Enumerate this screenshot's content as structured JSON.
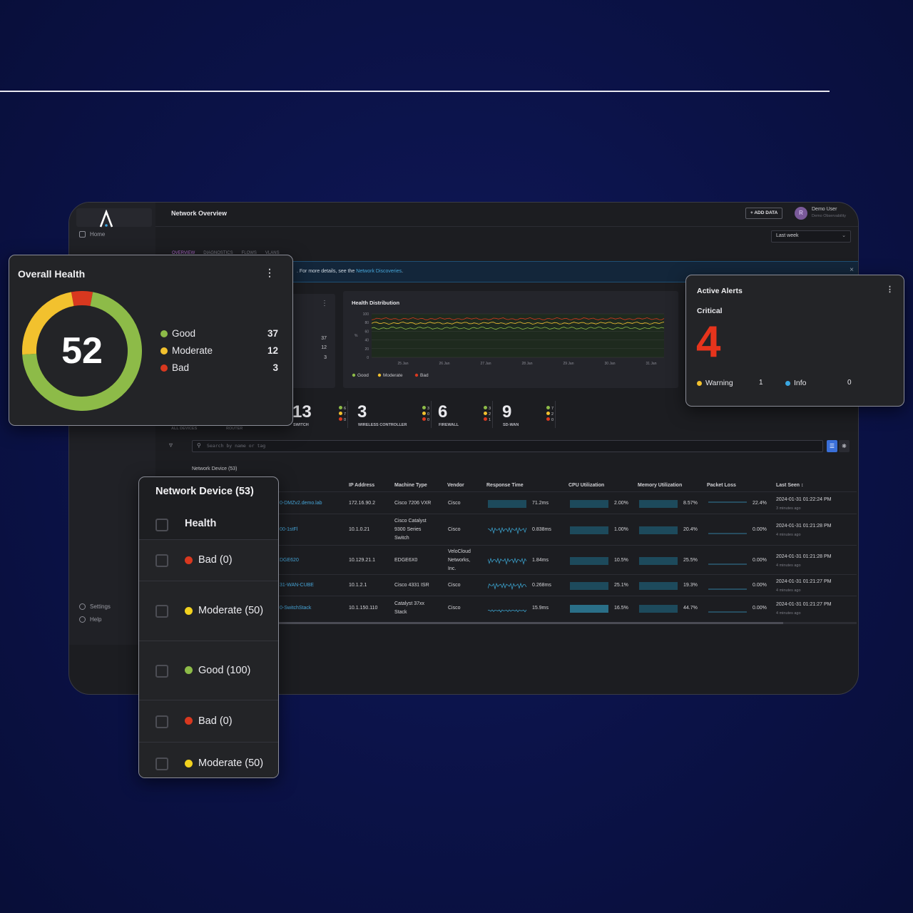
{
  "app": {
    "title": "Network Overview",
    "add_data_label": "+ ADD DATA",
    "user": {
      "avatar_initial": "R",
      "name": "Demo User",
      "org": "Demo Observability"
    },
    "time_range": "Last week",
    "sidebar": {
      "items": [
        {
          "label": "Home",
          "icon": "home-icon"
        },
        {
          "label": "Settings",
          "icon": "gear-icon"
        },
        {
          "label": "Help",
          "icon": "help-icon"
        }
      ]
    },
    "tabs": [
      "OVERVIEW",
      "DIAGNOSTICS",
      "FLOWS",
      "VLANS"
    ],
    "banner": {
      "message": ". For more details, see the ",
      "link": "Network Discoveries",
      "end": "."
    }
  },
  "health_counts_panel": {
    "good": "37",
    "moderate": "12",
    "bad": "3"
  },
  "health_distribution": {
    "title": "Health Distribution",
    "y_ticks": [
      "100",
      "80",
      "60",
      "40",
      "20",
      "0"
    ],
    "y_label": "%",
    "x_ticks": [
      "25 Jan",
      "26 Jan",
      "27 Jan",
      "28 Jan",
      "29 Jan",
      "30 Jan",
      "31 Jan"
    ],
    "legend": [
      {
        "label": "Good",
        "color": "#8dbb48"
      },
      {
        "label": "Moderate",
        "color": "#f2c12e"
      },
      {
        "label": "Bad",
        "color": "#d8381f"
      }
    ]
  },
  "categories": [
    {
      "count": "13",
      "label": "SWITCH",
      "good": "6",
      "moderate": "7",
      "bad": "0"
    },
    {
      "count": "3",
      "label": "WIRELESS CONTROLLER",
      "good": "3",
      "moderate": "0",
      "bad": "0"
    },
    {
      "count": "6",
      "label": "FIREWALL",
      "good": "3",
      "moderate": "2",
      "bad": "1"
    },
    {
      "count": "9",
      "label": "SD-WAN",
      "good": "7",
      "moderate": "2",
      "bad": "0"
    }
  ],
  "category_left_labels": [
    "ALL DEVICES",
    "ROUTER"
  ],
  "search_placeholder": "Search by name or tag",
  "table": {
    "caption": "Network Device (53)",
    "columns": [
      "IP Address",
      "Machine Type",
      "Vendor",
      "Response Time",
      "CPU Utilization",
      "Memory Utilization",
      "Packet Loss",
      "Last Seen"
    ],
    "rows": [
      {
        "name": "0-DMZv2.demo.lab",
        "ip": "172.16.90.2",
        "type": [
          "Cisco 7206 VXR"
        ],
        "vendor": [
          "Cisco"
        ],
        "response": "71.2ms",
        "cpu": "2.00%",
        "mem": "8.57%",
        "loss": "22.4%",
        "seen": "2024-01-31 01:22:24 PM",
        "seen_ago": "3 minutes ago"
      },
      {
        "name": "00-1stFl",
        "ip": "10.1.0.21",
        "type": [
          "Cisco Catalyst",
          "9300 Series",
          "Switch"
        ],
        "vendor": [
          "Cisco"
        ],
        "response": "0.838ms",
        "cpu": "1.00%",
        "mem": "20.4%",
        "loss": "0.00%",
        "seen": "2024-01-31 01:21:28 PM",
        "seen_ago": "4 minutes ago"
      },
      {
        "name": "DGE620",
        "ip": "10.129.21.1",
        "type": [
          "EDGE6X0"
        ],
        "vendor": [
          "VeloCloud",
          "Networks,",
          "Inc."
        ],
        "response": "1.84ms",
        "cpu": "10.5%",
        "mem": "25.5%",
        "loss": "0.00%",
        "seen": "2024-01-31 01:21:28 PM",
        "seen_ago": "4 minutes ago"
      },
      {
        "name": "31-WAN-CUBE",
        "ip": "10.1.2.1",
        "type": [
          "Cisco 4331 ISR"
        ],
        "vendor": [
          "Cisco"
        ],
        "response": "0.268ms",
        "cpu": "25.1%",
        "mem": "19.3%",
        "loss": "0.00%",
        "seen": "2024-01-31 01:21:27 PM",
        "seen_ago": "4 minutes ago"
      },
      {
        "name": "0-SwitchStack",
        "ip": "10.1.150.110",
        "type": [
          "Catalyst 37xx",
          "Stack"
        ],
        "vendor": [
          "Cisco"
        ],
        "response": "15.9ms",
        "cpu": "16.5%",
        "mem": "44.7%",
        "loss": "0.00%",
        "seen": "2024-01-31 01:21:27 PM",
        "seen_ago": "4 minutes ago"
      }
    ]
  },
  "overall_health": {
    "title": "Overall Health",
    "score": "52",
    "legend": [
      {
        "label": "Good",
        "count": "37",
        "color": "#8dbb48"
      },
      {
        "label": "Moderate",
        "count": "12",
        "color": "#f2c12e"
      },
      {
        "label": "Bad",
        "count": "3",
        "color": "#d8381f"
      }
    ],
    "track_color": "#1a1b1e"
  },
  "active_alerts": {
    "title": "Active Alerts",
    "critical_label": "Critical",
    "critical_count": "4",
    "warning_label": "Warning",
    "warning_count": "1",
    "info_label": "Info",
    "info_count": "0",
    "colors": {
      "critical": "#e6341c",
      "warning": "#f2c12e",
      "info": "#3aa6e0"
    }
  },
  "network_device_filter": {
    "title": "Network Device (53)",
    "header": "Health",
    "options": [
      {
        "label": "Bad (0)",
        "color": "#d8381f"
      },
      {
        "label": "Moderate (50)",
        "color": "#f2d21e"
      },
      {
        "label": "Good (100)",
        "color": "#8dbb48"
      },
      {
        "label": "Bad (0)",
        "color": "#d8381f"
      },
      {
        "label": "Moderate (50)",
        "color": "#f2d21e"
      }
    ]
  }
}
